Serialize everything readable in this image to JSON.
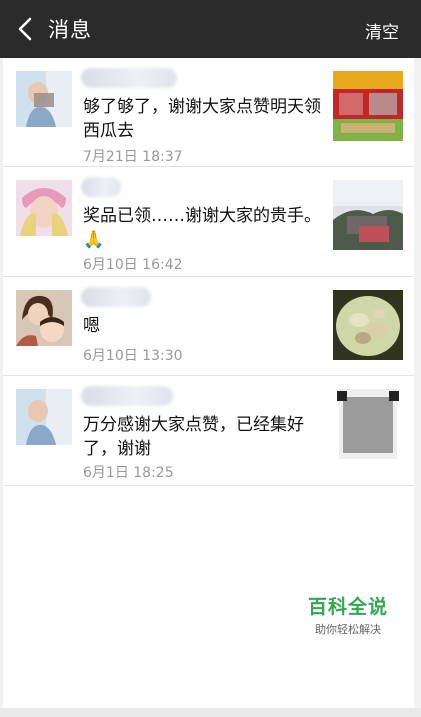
{
  "header": {
    "title": "消息",
    "clear_label": "清空"
  },
  "messages": [
    {
      "text": "够了够了，谢谢大家点赞明天领西瓜去",
      "time": "7月21日 18:37"
    },
    {
      "text": "奖品已领……谢谢大家的贵手。🙏",
      "time": "6月10日 16:42"
    },
    {
      "text": "嗯",
      "time": "6月10日 13:30"
    },
    {
      "text": "万分感谢大家点赞，已经集好了，谢谢",
      "time": "6月1日 18:25"
    }
  ],
  "watermark": {
    "title": "百科全说",
    "subtitle": "助你轻松解决"
  },
  "colors": {
    "header_bg": "#2b2b2b",
    "time_text": "#999999",
    "watermark_green": "#2fa84f"
  }
}
